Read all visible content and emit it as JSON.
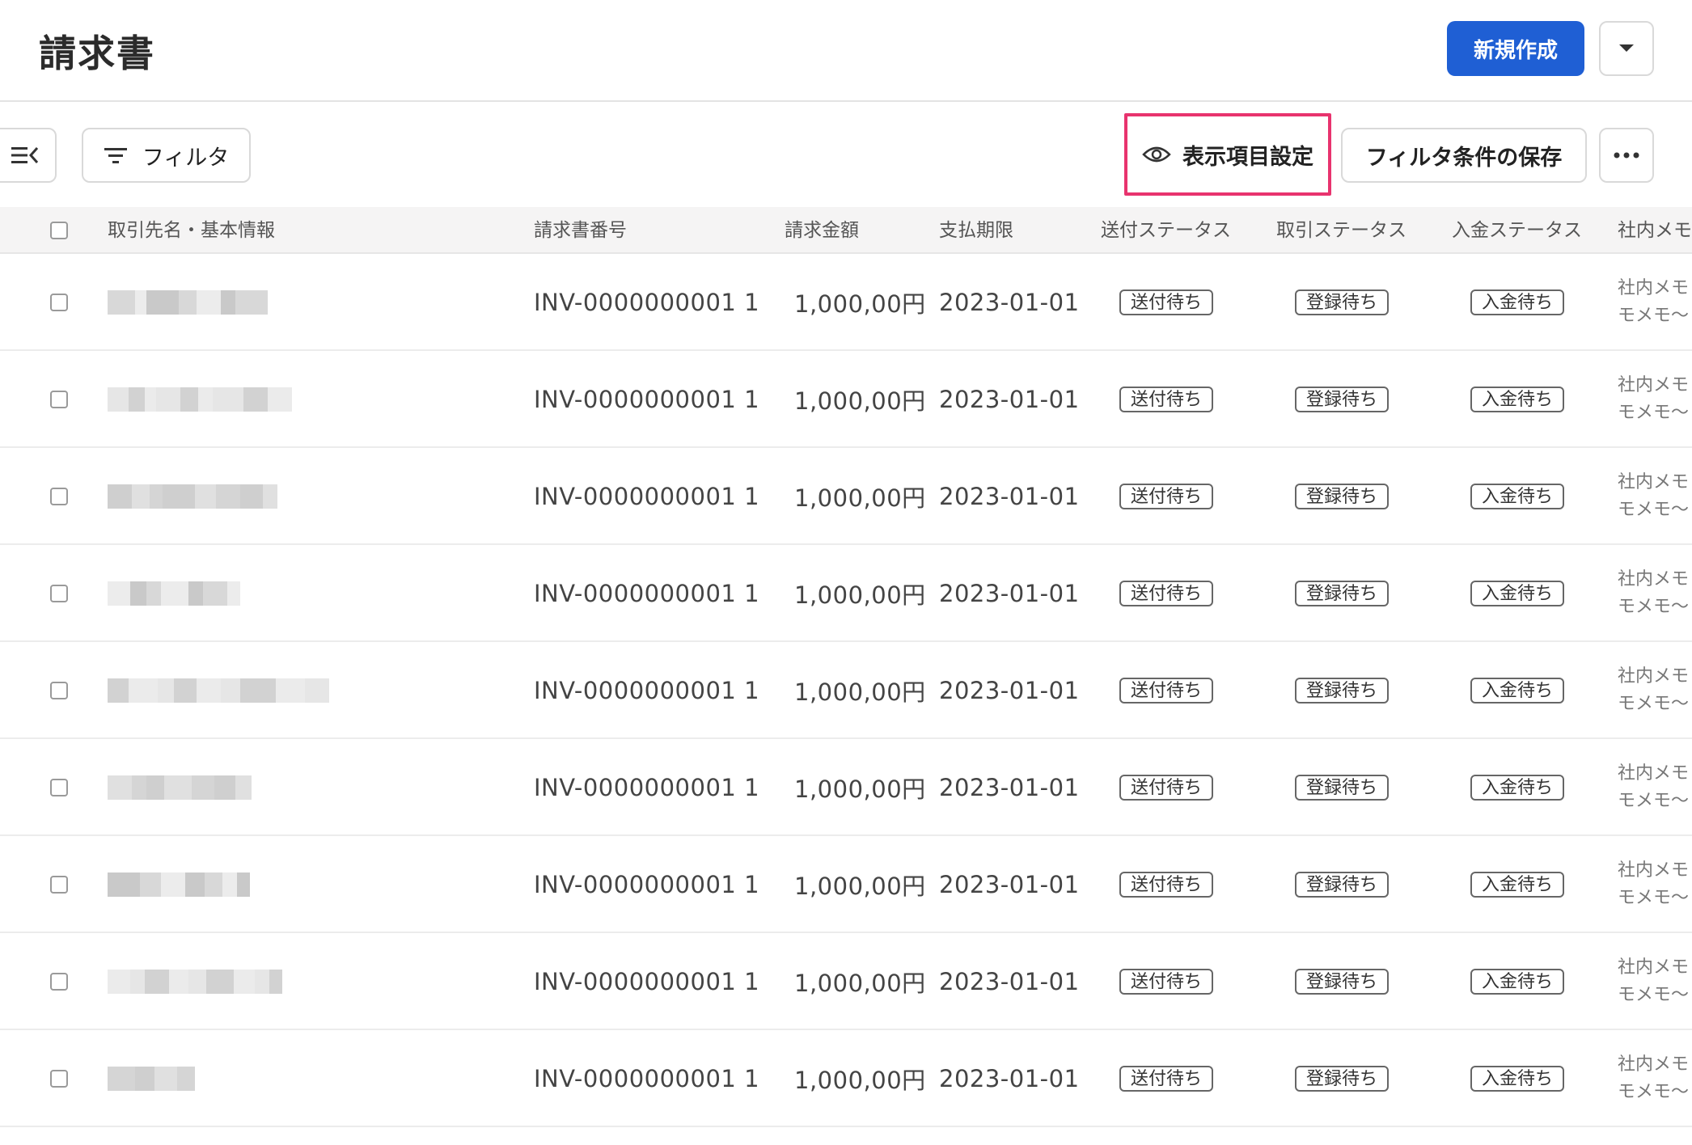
{
  "header": {
    "title": "請求書",
    "new_button": "新規作成"
  },
  "toolbar": {
    "filter_label": "フィルタ",
    "columns_label": "表示項目設定",
    "save_filter_label": "フィルタ条件の保存"
  },
  "table": {
    "columns": {
      "name": "取引先名・基本情報",
      "invoice_no": "請求書番号",
      "amount": "請求金額",
      "due_date": "支払期限",
      "send_status": "送付ステータス",
      "trade_status": "取引ステータス",
      "payment_status": "入金ステータス",
      "memo": "社内メモ"
    },
    "rows": [
      {
        "invoice_no": "INV-0000000001 1",
        "amount": "1,000,00円",
        "due_date": "2023-01-01",
        "send_status": "送付待ち",
        "trade_status": "登録待ち",
        "payment_status": "入金待ち",
        "memo_line1": "社内メモ",
        "memo_line2": "モメモ〜"
      },
      {
        "invoice_no": "INV-0000000001 1",
        "amount": "1,000,00円",
        "due_date": "2023-01-01",
        "send_status": "送付待ち",
        "trade_status": "登録待ち",
        "payment_status": "入金待ち",
        "memo_line1": "社内メモ",
        "memo_line2": "モメモ〜"
      },
      {
        "invoice_no": "INV-0000000001 1",
        "amount": "1,000,00円",
        "due_date": "2023-01-01",
        "send_status": "送付待ち",
        "trade_status": "登録待ち",
        "payment_status": "入金待ち",
        "memo_line1": "社内メモ",
        "memo_line2": "モメモ〜"
      },
      {
        "invoice_no": "INV-0000000001 1",
        "amount": "1,000,00円",
        "due_date": "2023-01-01",
        "send_status": "送付待ち",
        "trade_status": "登録待ち",
        "payment_status": "入金待ち",
        "memo_line1": "社内メモ",
        "memo_line2": "モメモ〜"
      },
      {
        "invoice_no": "INV-0000000001 1",
        "amount": "1,000,00円",
        "due_date": "2023-01-01",
        "send_status": "送付待ち",
        "trade_status": "登録待ち",
        "payment_status": "入金待ち",
        "memo_line1": "社内メモ",
        "memo_line2": "モメモ〜"
      },
      {
        "invoice_no": "INV-0000000001 1",
        "amount": "1,000,00円",
        "due_date": "2023-01-01",
        "send_status": "送付待ち",
        "trade_status": "登録待ち",
        "payment_status": "入金待ち",
        "memo_line1": "社内メモ",
        "memo_line2": "モメモ〜"
      },
      {
        "invoice_no": "INV-0000000001 1",
        "amount": "1,000,00円",
        "due_date": "2023-01-01",
        "send_status": "送付待ち",
        "trade_status": "登録待ち",
        "payment_status": "入金待ち",
        "memo_line1": "社内メモ",
        "memo_line2": "モメモ〜"
      },
      {
        "invoice_no": "INV-0000000001 1",
        "amount": "1,000,00円",
        "due_date": "2023-01-01",
        "send_status": "送付待ち",
        "trade_status": "登録待ち",
        "payment_status": "入金待ち",
        "memo_line1": "社内メモ",
        "memo_line2": "モメモ〜"
      },
      {
        "invoice_no": "INV-0000000001 1",
        "amount": "1,000,00円",
        "due_date": "2023-01-01",
        "send_status": "送付待ち",
        "trade_status": "登録待ち",
        "payment_status": "入金待ち",
        "memo_line1": "社内メモ",
        "memo_line2": "モメモ〜"
      }
    ]
  },
  "colors": {
    "primary": "#1f5fd4",
    "highlight": "#e8336e"
  },
  "icons": {
    "collapse": "collapse-sidebar-icon",
    "filter": "filter-icon",
    "eye": "eye-icon",
    "more": "more-icon",
    "dropdown": "chevron-down-icon"
  }
}
